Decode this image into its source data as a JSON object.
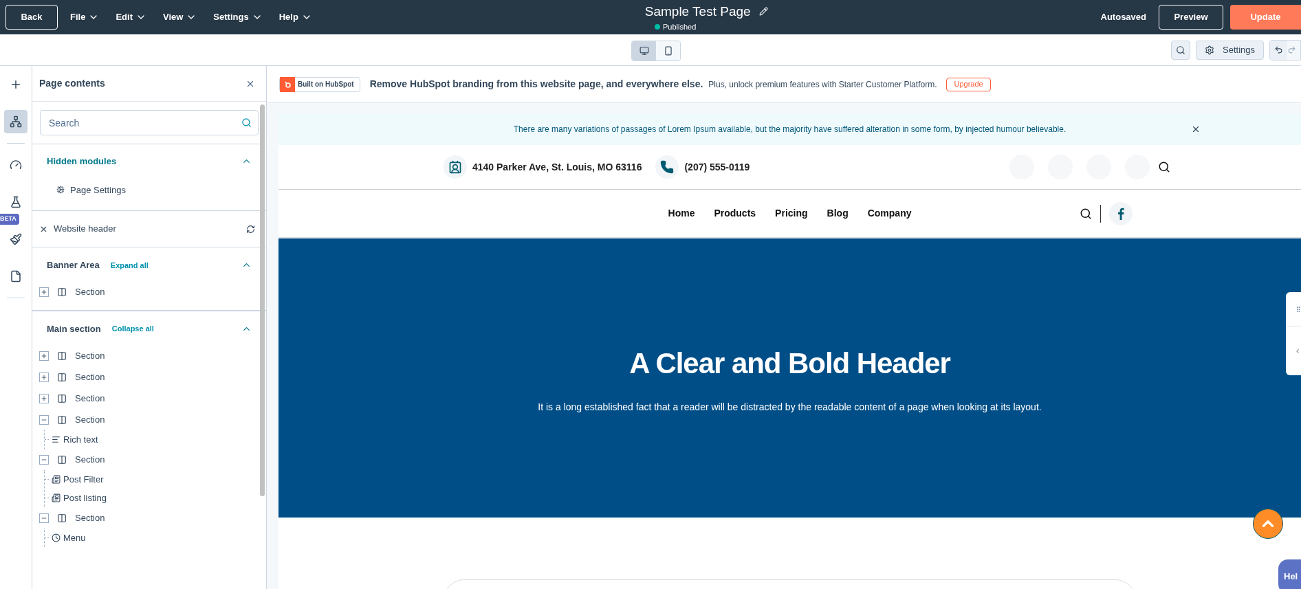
{
  "topbar": {
    "back": "Back",
    "menus": [
      "File",
      "Edit",
      "View",
      "Settings",
      "Help"
    ],
    "title": "Sample Test Page",
    "status": "Published",
    "autosaved": "Autosaved",
    "preview": "Preview",
    "update": "Update"
  },
  "toolbar": {
    "devices": [
      {
        "kind": "desktop",
        "selected": true
      },
      {
        "kind": "mobile",
        "selected": false
      }
    ],
    "settings": "Settings"
  },
  "rail": [
    {
      "kind": "add",
      "selected": false
    },
    {
      "kind": "tree",
      "selected": true
    },
    {
      "kind": "gauge",
      "selected": false
    },
    {
      "kind": "flask",
      "selected": false
    },
    {
      "kind": "brush",
      "selected": false,
      "badge": "BETA"
    },
    {
      "kind": "page",
      "selected": false
    }
  ],
  "panel": {
    "title": "Page contents",
    "search": {
      "placeholder": "Search"
    },
    "hidden": {
      "title": "Hidden modules",
      "expanded": true,
      "items": [
        "Page Settings"
      ]
    },
    "header_item": "Website header",
    "groups": [
      {
        "title": "Banner Area",
        "action": "Expand all",
        "expanded": true,
        "items": [
          {
            "label": "Section",
            "kind": "section",
            "expanded": false
          }
        ]
      },
      {
        "title": "Main section",
        "action": "Collapse all",
        "expanded": true,
        "items": [
          {
            "label": "Section",
            "kind": "section",
            "expanded": false
          },
          {
            "label": "Section",
            "kind": "section",
            "expanded": false
          },
          {
            "label": "Section",
            "kind": "section",
            "expanded": false
          },
          {
            "label": "Section",
            "kind": "section",
            "expanded": true,
            "children": [
              {
                "label": "Rich text",
                "kind": "richtext"
              }
            ]
          },
          {
            "label": "Section",
            "kind": "section",
            "expanded": true,
            "children": [
              {
                "label": "Post Filter",
                "kind": "post"
              },
              {
                "label": "Post listing",
                "kind": "post"
              }
            ]
          },
          {
            "label": "Section",
            "kind": "section",
            "expanded": true,
            "children": [
              {
                "label": "Menu",
                "kind": "menu"
              }
            ]
          }
        ]
      }
    ]
  },
  "promo": {
    "badge": "Built on HubSpot",
    "headline": "Remove HubSpot branding from this website page, and everywhere else.",
    "text": "Plus, unlock premium features with Starter Customer Platform.",
    "button": "Upgrade"
  },
  "site": {
    "notice": "There are many variations of passages of Lorem Ipsum available, but the majority have suffered alteration in some form, by injected humour believable.",
    "address": "4140 Parker Ave, St. Louis, MO 63116",
    "phone": "(207) 555-0119",
    "nav": [
      "Home",
      "Products",
      "Pricing",
      "Blog",
      "Company"
    ],
    "hero_title": "A Clear and Bold Header",
    "hero_text": "It is a long established fact that a reader will be distracted by the readable content of a page when looking at its layout."
  },
  "help": "Hel"
}
